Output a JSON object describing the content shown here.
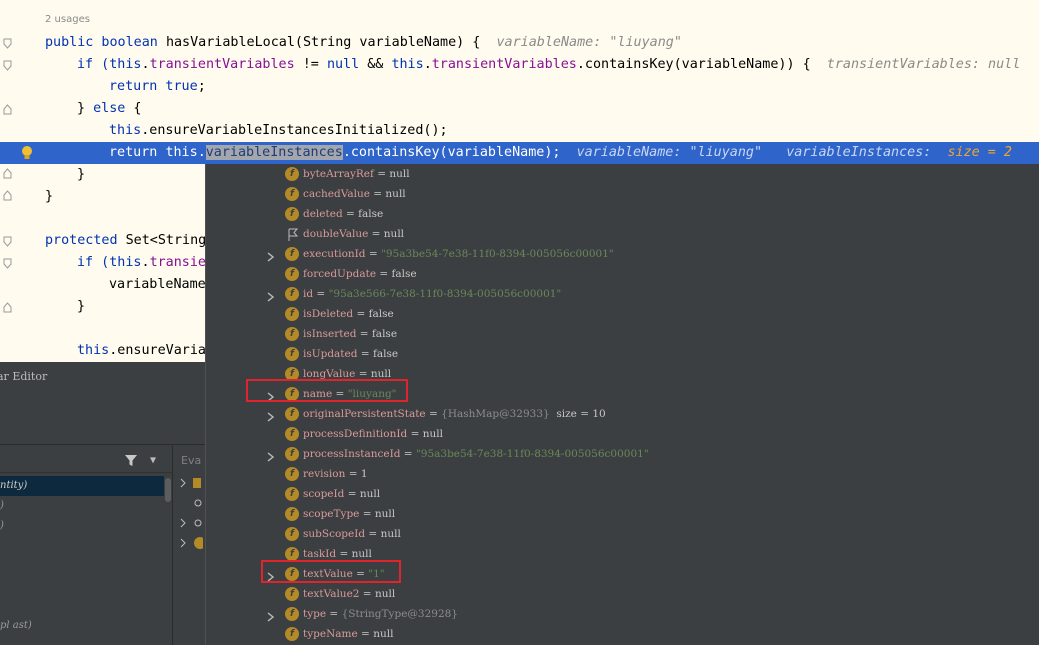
{
  "editor": {
    "usages": "2 usages",
    "lines": {
      "l1": {
        "kw": "public boolean ",
        "name": "hasVariableLocal(",
        "type": "String",
        "rest": " variableName) {  ",
        "hint": "variableName: \"liuyang\""
      },
      "l2": {
        "kw1": "if (",
        "kw2": "this",
        "dot1": ".",
        "fld1": "transientVariables",
        "op1": " != ",
        "kw3": "null",
        "op2": " && ",
        "kw4": "this",
        "dot2": ".",
        "fld2": "transientVariables",
        "rest": ".containsKey(variableName)) {  ",
        "hint": "transientVariables: null"
      },
      "l3": {
        "kw": "return true",
        "rest": ";"
      },
      "l4": {
        "a": "} ",
        "kw": "else",
        "b": " {"
      },
      "l5": {
        "kw": "this",
        "rest": ".ensureVariableInstancesInitialized();"
      },
      "l6": {
        "kw1": "return ",
        "kw2": "this",
        "dot": ".",
        "sel": "variableInstances",
        "rest": ".containsKey(variableName);  ",
        "hint1": "variableName: \"liuyang\"",
        "hint2": "   variableInstances:  ",
        "hint3": "size = 2"
      },
      "l7": {
        "text": "}"
      },
      "l8": {
        "text": "}"
      },
      "l9": {
        "kw": "protected ",
        "rest": "Set<String"
      },
      "l10": {
        "kw1": "if (",
        "kw2": "this",
        "dot": ".",
        "fld": "transie"
      },
      "l11": {
        "text": "variableName"
      },
      "l12": {
        "text": "}"
      },
      "l13": {
        "kw": "this",
        "rest": ".ensureVaria"
      }
    }
  },
  "debug": {
    "title": "ar Editor",
    "eval_label": "Eva",
    "frames": [
      {
        "label": "ntity)"
      },
      {
        "label": ")"
      },
      {
        "label": ")"
      },
      {
        "label": "pl ast)"
      }
    ]
  },
  "popup": {
    "nodes": [
      {
        "name": "byteArrayRef",
        "value": "null",
        "kind": "null",
        "expandable": false,
        "icon": "field"
      },
      {
        "name": "cachedValue",
        "value": "null",
        "kind": "null",
        "expandable": false,
        "icon": "field"
      },
      {
        "name": "deleted",
        "value": "false",
        "kind": "null",
        "expandable": false,
        "icon": "field"
      },
      {
        "name": "doubleValue",
        "value": "null",
        "kind": "null",
        "expandable": false,
        "icon": "flag"
      },
      {
        "name": "executionId",
        "value": "\"95a3be54-7e38-11f0-8394-005056c00001\"",
        "kind": "str",
        "expandable": true,
        "icon": "field"
      },
      {
        "name": "forcedUpdate",
        "value": "false",
        "kind": "null",
        "expandable": false,
        "icon": "field"
      },
      {
        "name": "id",
        "value": "\"95a3e566-7e38-11f0-8394-005056c00001\"",
        "kind": "str",
        "expandable": true,
        "icon": "field"
      },
      {
        "name": "isDeleted",
        "value": "false",
        "kind": "null",
        "expandable": false,
        "icon": "field"
      },
      {
        "name": "isInserted",
        "value": "false",
        "kind": "null",
        "expandable": false,
        "icon": "field"
      },
      {
        "name": "isUpdated",
        "value": "false",
        "kind": "null",
        "expandable": false,
        "icon": "field"
      },
      {
        "name": "longValue",
        "value": "null",
        "kind": "null",
        "expandable": false,
        "icon": "field"
      },
      {
        "name": "name",
        "value": "\"liuyang\"",
        "kind": "str",
        "expandable": true,
        "icon": "field"
      },
      {
        "name": "originalPersistentState",
        "value": "{HashMap@32933}",
        "kind": "ref",
        "extra": "  size = 10",
        "expandable": true,
        "icon": "field"
      },
      {
        "name": "processDefinitionId",
        "value": "null",
        "kind": "null",
        "expandable": false,
        "icon": "field"
      },
      {
        "name": "processInstanceId",
        "value": "\"95a3be54-7e38-11f0-8394-005056c00001\"",
        "kind": "str",
        "expandable": true,
        "icon": "field"
      },
      {
        "name": "revision",
        "value": "1",
        "kind": "null",
        "expandable": false,
        "icon": "field"
      },
      {
        "name": "scopeId",
        "value": "null",
        "kind": "null",
        "expandable": false,
        "icon": "field"
      },
      {
        "name": "scopeType",
        "value": "null",
        "kind": "null",
        "expandable": false,
        "icon": "field"
      },
      {
        "name": "subScopeId",
        "value": "null",
        "kind": "null",
        "expandable": false,
        "icon": "field"
      },
      {
        "name": "taskId",
        "value": "null",
        "kind": "null",
        "expandable": false,
        "icon": "field"
      },
      {
        "name": "textValue",
        "value": "\"1\"",
        "kind": "str",
        "expandable": true,
        "icon": "field"
      },
      {
        "name": "textValue2",
        "value": "null",
        "kind": "null",
        "expandable": false,
        "icon": "field"
      },
      {
        "name": "type",
        "value": "{StringType@32928}",
        "kind": "ref",
        "expandable": true,
        "icon": "field"
      },
      {
        "name": "typeName",
        "value": "null",
        "kind": "null",
        "expandable": false,
        "icon": "field"
      }
    ]
  },
  "colors": {
    "highlight_box": "#e0242b",
    "execution_line": "#2f65ca",
    "field_icon": "#b48a27"
  }
}
